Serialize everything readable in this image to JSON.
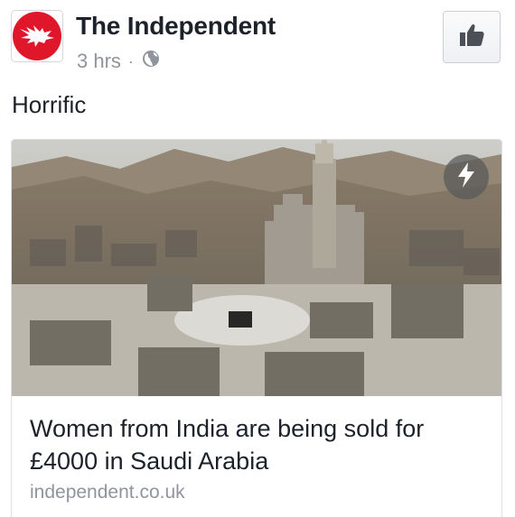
{
  "post": {
    "page_name": "The Independent",
    "time": "3 hrs",
    "separator": "·",
    "audience_icon": "globe-icon",
    "like_icon": "thumbs-up-icon",
    "message": "Horrific"
  },
  "link_card": {
    "title": "Women from India are being sold for £4000 in Saudi Arabia",
    "domain": "independent.co.uk",
    "badge_icon": "lightning-bolt-icon",
    "image_alt": "aerial-city-photo"
  },
  "colors": {
    "brand_red": "#e0162b",
    "text_primary": "#1d2129",
    "text_secondary": "#90949c"
  }
}
